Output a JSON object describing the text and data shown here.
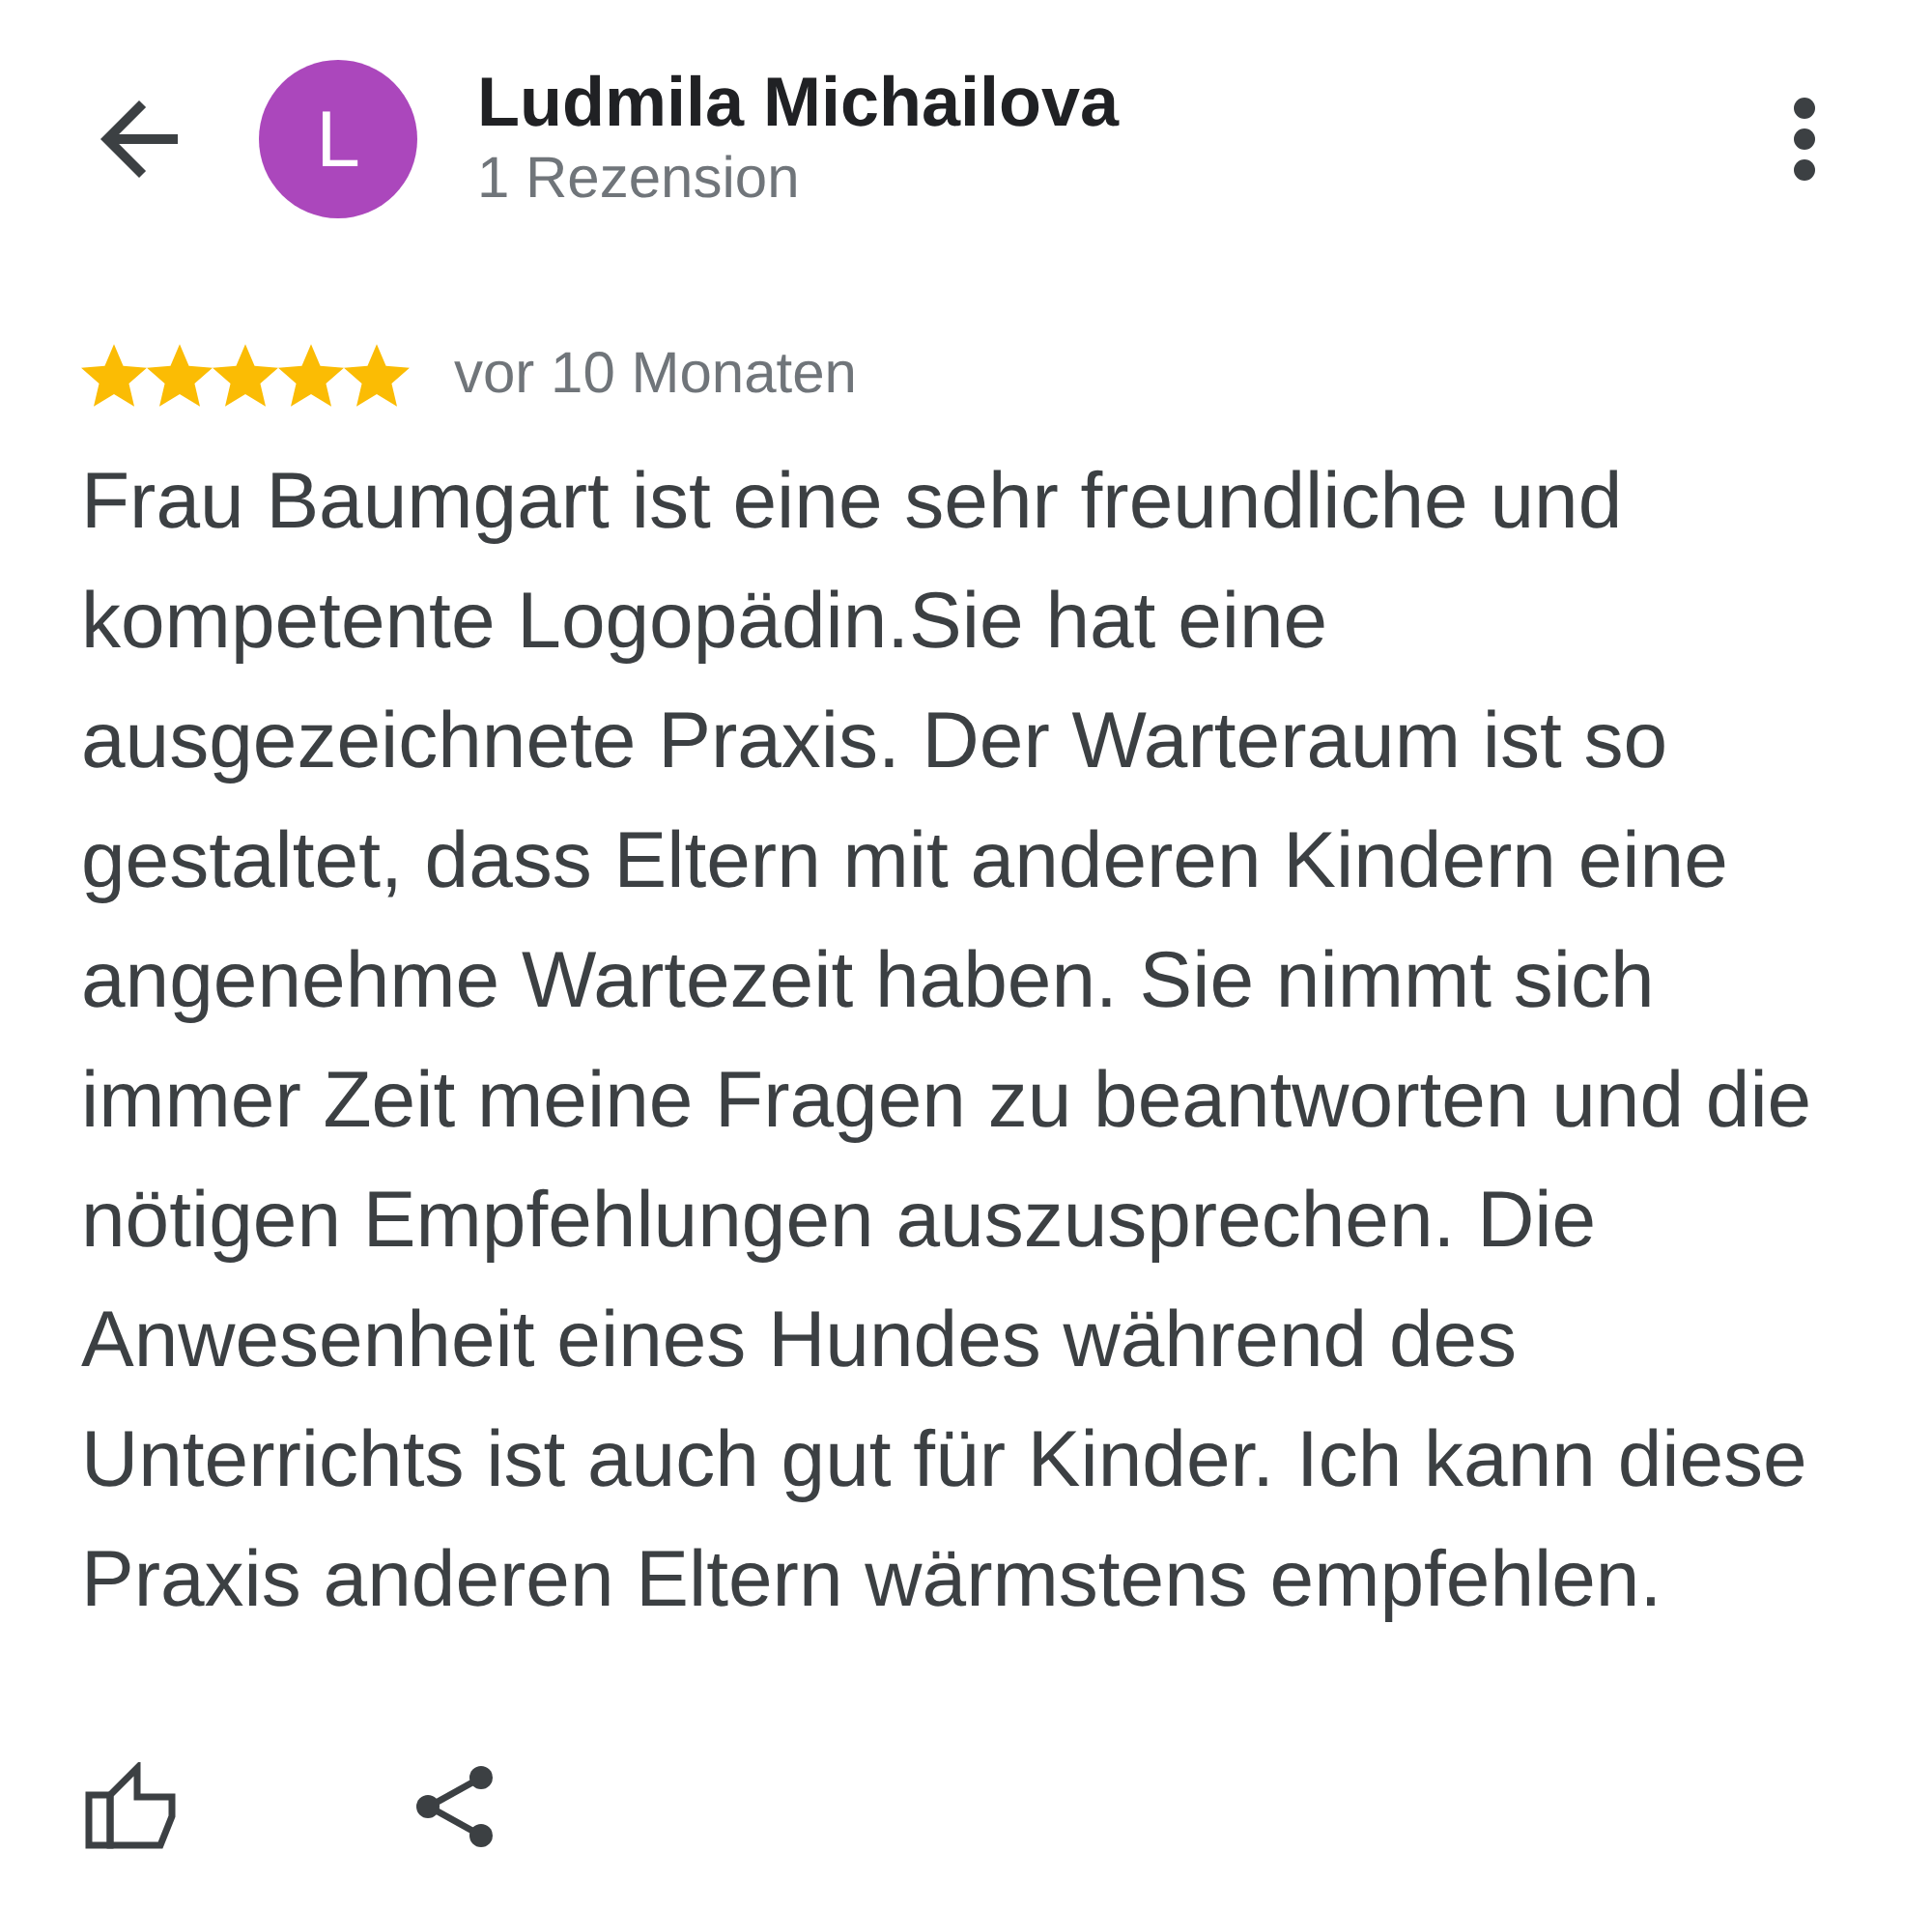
{
  "header": {
    "avatar_letter": "L",
    "name": "Ludmila Michailova",
    "review_count": "1 Rezension"
  },
  "review": {
    "stars": 5,
    "time": "vor 10 Monaten",
    "text": "Frau Baumgart ist eine sehr freundliche und kompetente Logopädin.Sie hat eine ausgezeichnete Praxis. Der Warteraum ist so gestaltet, dass Eltern mit anderen Kindern eine angenehme Wartezeit haben. Sie nimmt sich immer Zeit meine Fragen zu beantworten und die nötigen Empfehlungen auszusprechen. Die Anwesenheit eines Hundes während des Unterrichts ist auch gut für Kinder. Ich kann diese Praxis anderen Eltern wärmstens empfehlen."
  }
}
